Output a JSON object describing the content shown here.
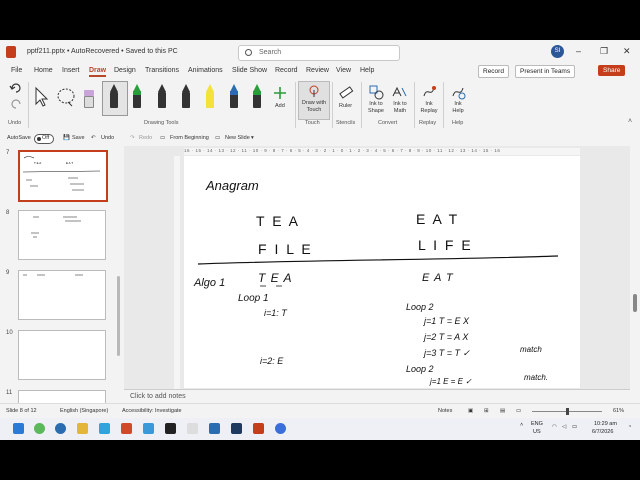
{
  "window": {
    "title": "pptf211.pptx  •  AutoRecovered  •  Saved to this PC",
    "search_placeholder": "Search",
    "user_initials": "SI",
    "minimize": "–",
    "restore": "❐",
    "close": "✕"
  },
  "menu": {
    "tabs": [
      "File",
      "Home",
      "Insert",
      "Draw",
      "Design",
      "Transitions",
      "Animations",
      "Slide Show",
      "Record",
      "Review",
      "View",
      "Help"
    ],
    "active_tab": "Draw",
    "record_label": "Record",
    "present_label": "Present in Teams",
    "share_label": "Share"
  },
  "ribbon": {
    "groups": {
      "undo": "Undo",
      "drawing_tools": "Drawing Tools",
      "touch": "Touch",
      "stencils": "Stencils",
      "convert": "Convert",
      "replay": "Replay",
      "help": "Help"
    },
    "add_label": "Add",
    "draw_with_touch": "Draw with Touch",
    "ruler": "Ruler",
    "ink_to_shape": "Ink to Shape",
    "ink_to_math": "Ink to Math",
    "ink_replay": "Ink Replay",
    "ink_help": "Ink Help",
    "pen_colors": [
      "#111111",
      "#2a9d3a",
      "#111111",
      "#111111",
      "#f2e23a",
      "#2b6cb0",
      "#2a9d3a"
    ]
  },
  "qat": {
    "autosave": "AutoSave",
    "toggle": "Off",
    "save": "Save",
    "undo": "Undo",
    "redo": "Redo",
    "from_beginning": "From Beginning",
    "new_slide": "New Slide"
  },
  "thumbnails": [
    {
      "num": "7",
      "selected": true
    },
    {
      "num": "8",
      "selected": false
    },
    {
      "num": "9",
      "selected": false
    },
    {
      "num": "10",
      "selected": false
    },
    {
      "num": "11",
      "selected": false
    }
  ],
  "ruler_text": "16 · 15 · 14 · 13 · 12 · 11 · 10 · 9 · 8 · 7 · 6 · 5 · 4 · 3 · 2 · 1 · 0 · 1 · 2 · 3 · 4 · 5 · 6 · 7 · 8 · 9 · 10 · 11 · 12 · 13 · 14 · 15 · 16",
  "slide": {
    "heading": "Anagram",
    "word1": "T E A",
    "word2": "E A T",
    "word3": "F I L E",
    "word4": "L I F E",
    "algo": "Algo 1",
    "left_tea": "T E A",
    "loop1": "Loop 1",
    "i1": "i=1:  T",
    "i2": "i=2:  E",
    "right_eat": "E A T",
    "loop2": "Loop 2",
    "j1": "j=1    T = E   X",
    "j2": "j=2    T = A   X",
    "j3": "j=3    T = T   ✓",
    "match1": "match",
    "loop2b": "Loop 2",
    "j1b": "j=1    E = E   ✓",
    "match2": "match."
  },
  "notes_placeholder": "Click to add notes",
  "status": {
    "slide": "Slide 8 of 12",
    "language": "English (Singapore)",
    "accessibility": "Accessibility: Investigate",
    "notes": "Notes",
    "zoom": "61%"
  },
  "tray": {
    "lang1": "ENG",
    "lang2": "US",
    "time": "10:29 am",
    "date": "6/7/2026"
  }
}
